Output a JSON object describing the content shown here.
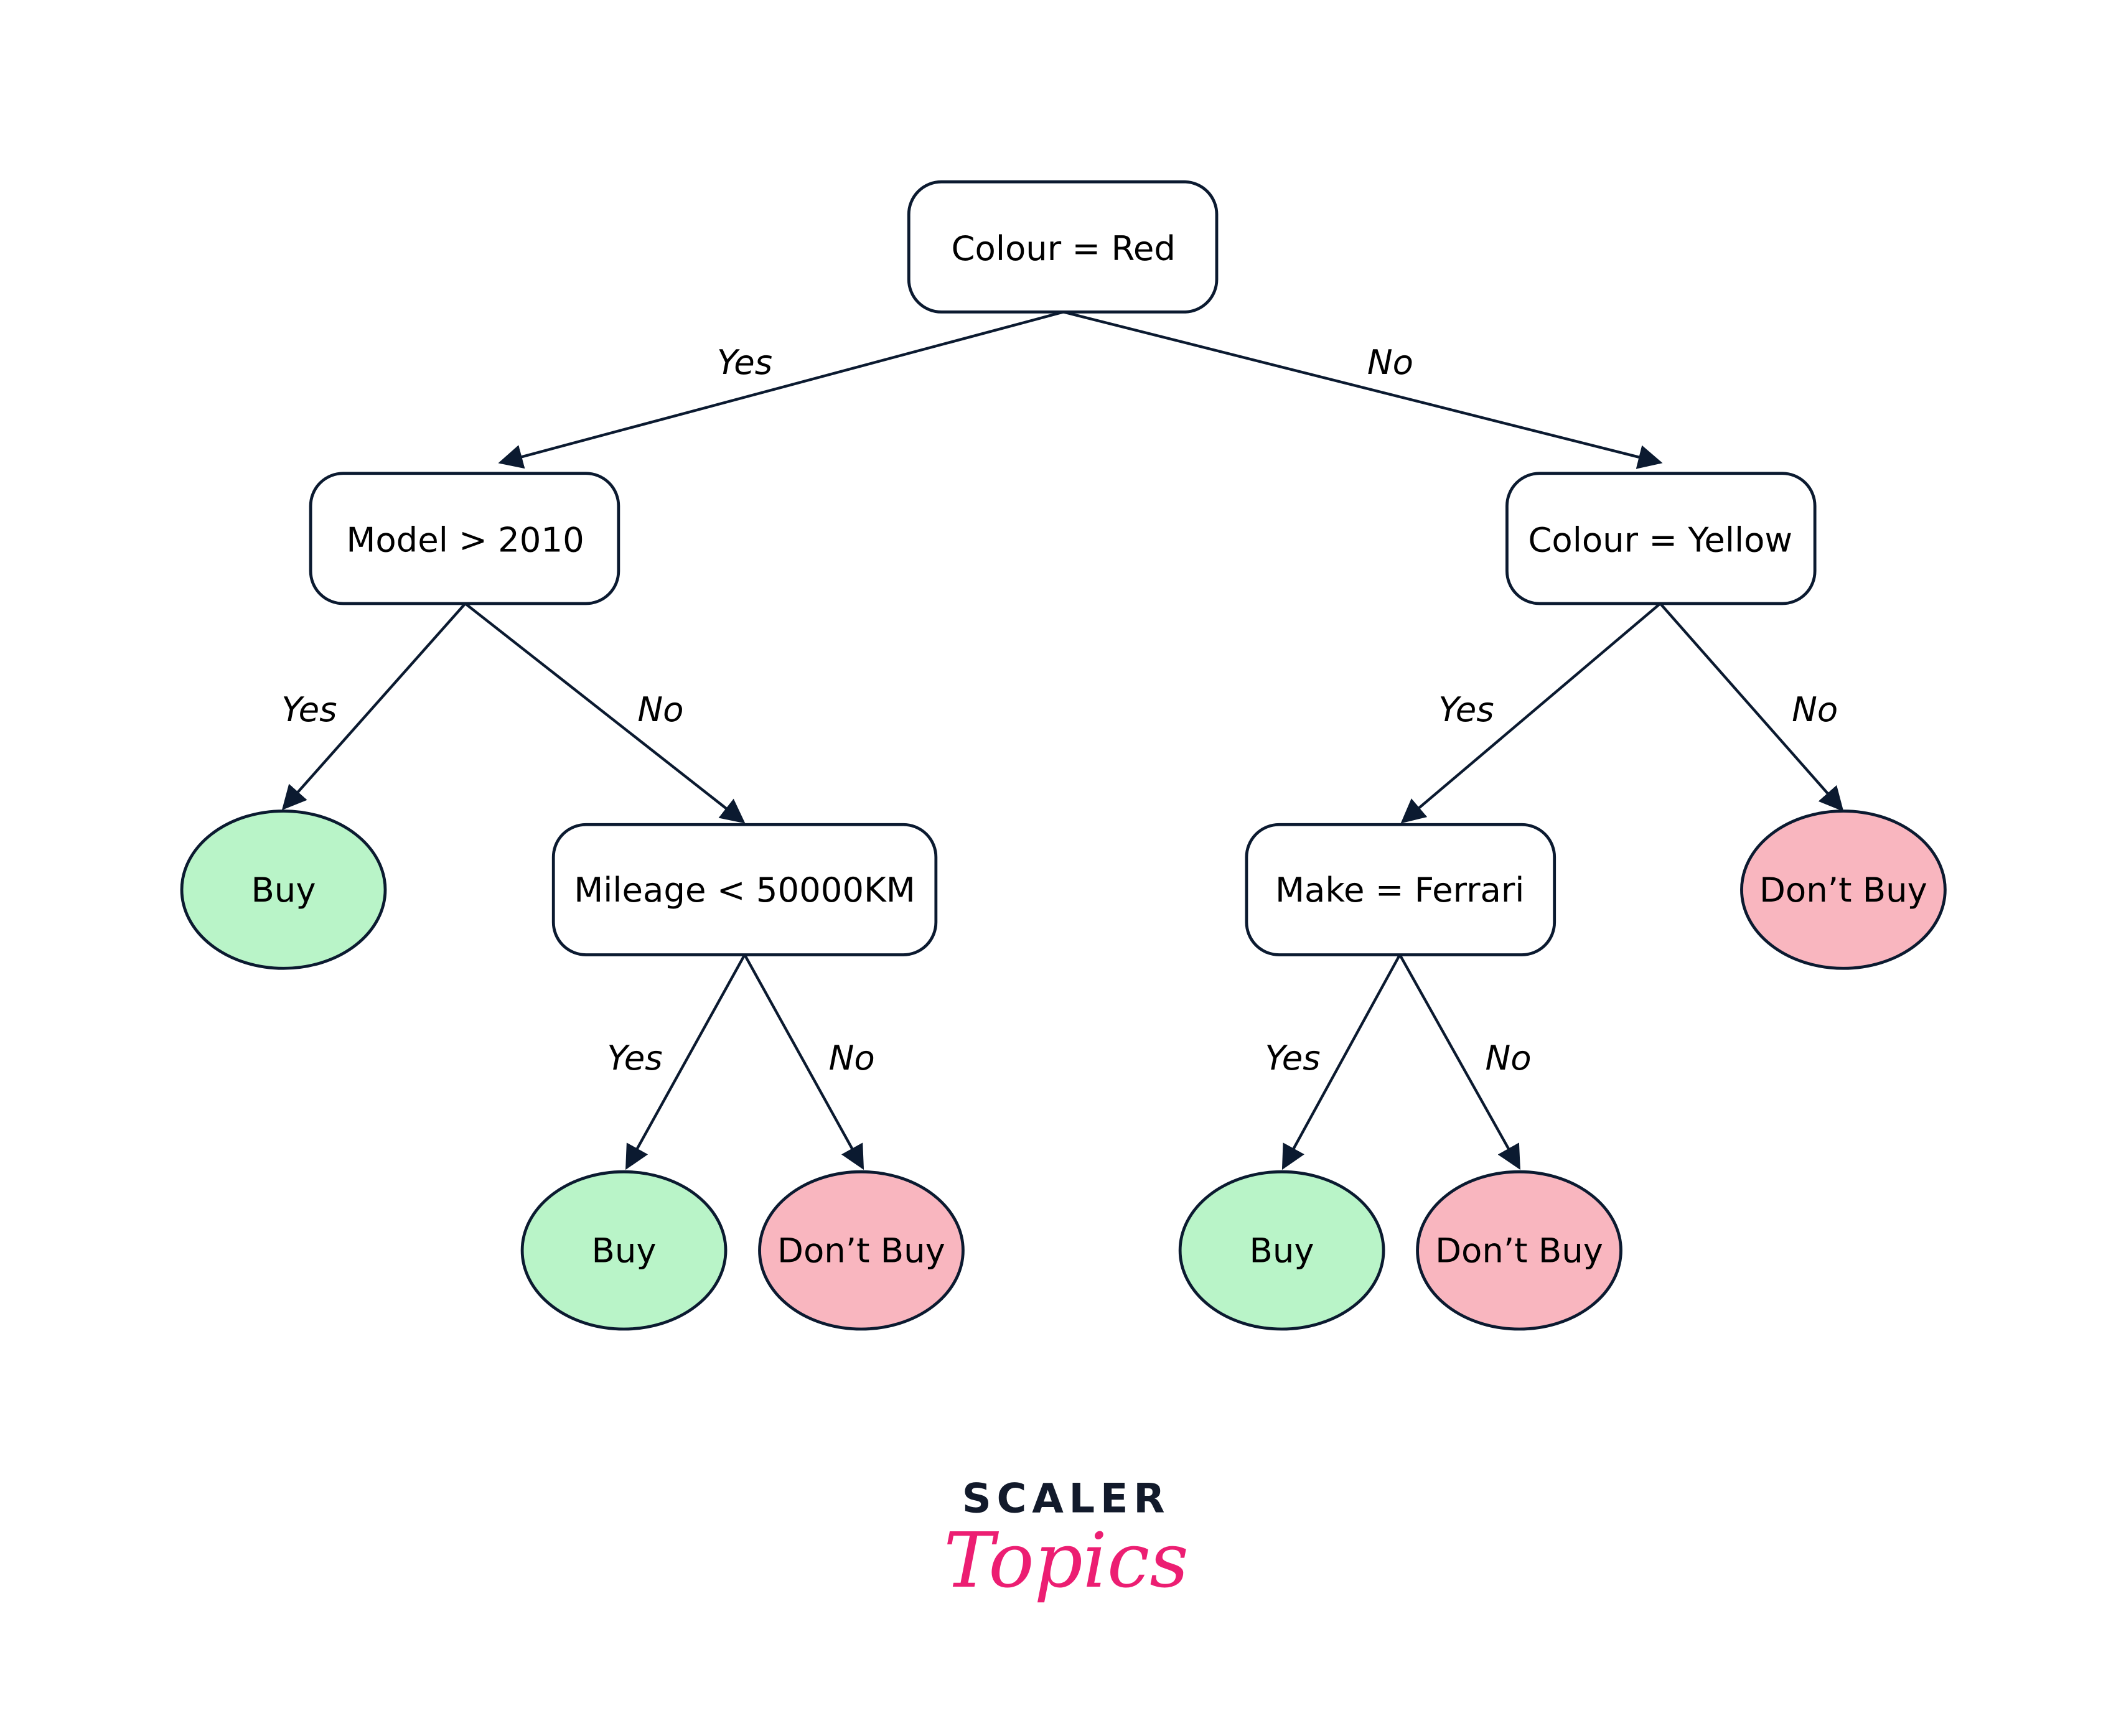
{
  "diagram": {
    "type": "decision-tree",
    "colors": {
      "stroke": "#0b1a30",
      "buy_fill": "#b9f4c8",
      "dont_buy_fill": "#f9b6bf",
      "logo_dark": "#121a2b",
      "logo_pink": "#ec1e72"
    },
    "nodes": {
      "root": "Colour = Red",
      "model": "Model > 2010",
      "colour_yellow": "Colour = Yellow",
      "mileage": "Mileage < 50000KM",
      "make": "Make = Ferrari",
      "leaf_model_yes": "Buy",
      "leaf_yellow_no": "Don’t Buy",
      "leaf_mileage_yes": "Buy",
      "leaf_mileage_no": "Don’t Buy",
      "leaf_make_yes": "Buy",
      "leaf_make_no": "Don’t Buy"
    },
    "edges": {
      "root_yes": "Yes",
      "root_no": "No",
      "model_yes": "Yes",
      "model_no": "No",
      "yellow_yes": "Yes",
      "yellow_no": "No",
      "mileage_yes": "Yes",
      "mileage_no": "No",
      "make_yes": "Yes",
      "make_no": "No"
    }
  },
  "logo": {
    "top": "SCALER",
    "bottom": "Topics"
  }
}
